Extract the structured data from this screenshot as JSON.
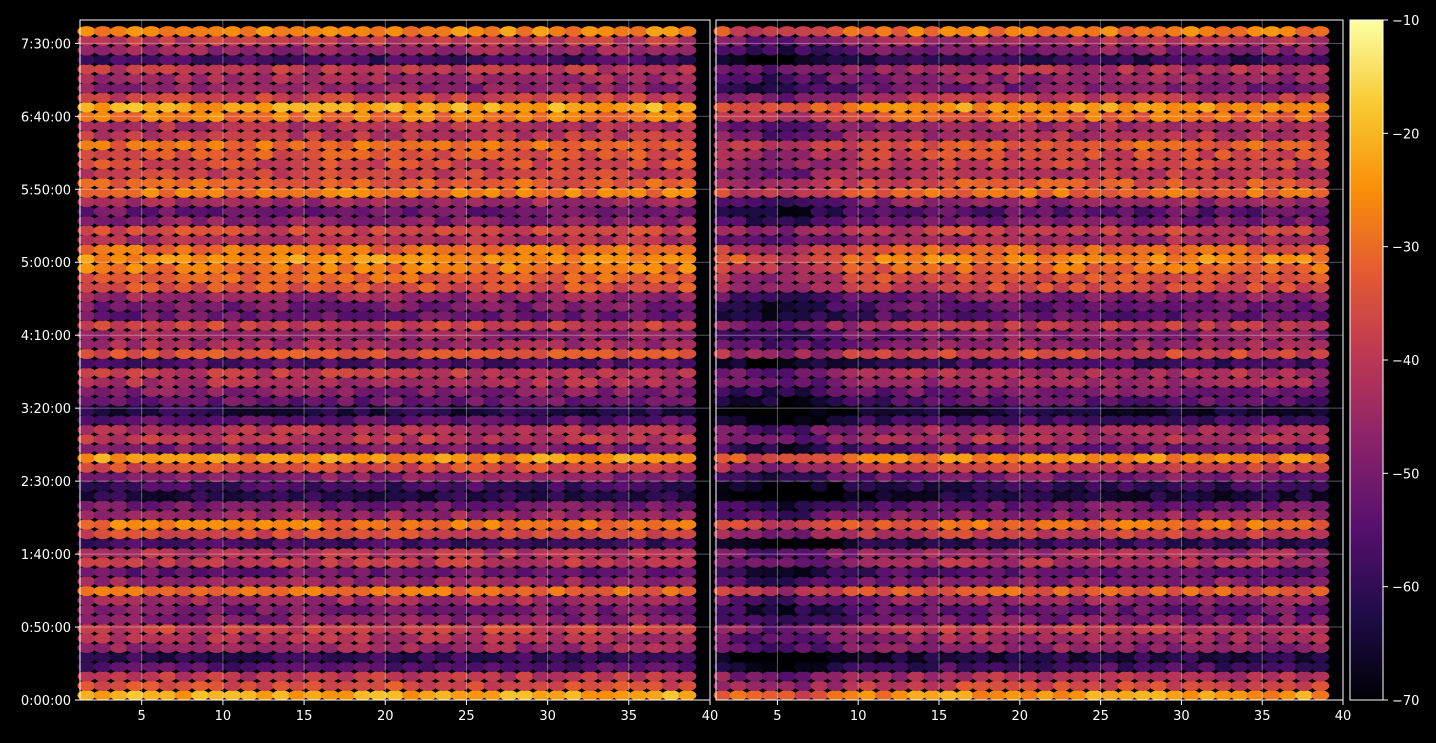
{
  "chart_data": {
    "type": "heatmap",
    "title": "",
    "xlabel": "",
    "ylabel": "",
    "panels": [
      {
        "name": "",
        "x_tick_labels": [
          "5",
          "10",
          "15",
          "20",
          "25",
          "30",
          "35",
          "40"
        ],
        "xlim": [
          1.2,
          40
        ]
      },
      {
        "name": "",
        "x_tick_labels": [
          "5",
          "10",
          "15",
          "20",
          "25",
          "30",
          "35",
          "40"
        ],
        "xlim": [
          1.2,
          40
        ]
      }
    ],
    "x_ticks": [
      5,
      10,
      15,
      20,
      25,
      30,
      35,
      40
    ],
    "y_ticks": [
      "0:00:00",
      "0:50:00",
      "1:40:00",
      "2:30:00",
      "3:20:00",
      "4:10:00",
      "5:00:00",
      "5:50:00",
      "6:40:00",
      "7:30:00"
    ],
    "ylim_seconds": [
      0,
      27960
    ],
    "row_interval_seconds": 600,
    "colorbar": {
      "colormap": "inferno",
      "ticks": [
        -10,
        -20,
        -30,
        -40,
        -50,
        -60,
        -70
      ],
      "tick_labels": [
        "−10",
        "−20",
        "−30",
        "−40",
        "−50",
        "−60",
        "−70"
      ],
      "range": [
        -70,
        -10
      ]
    },
    "grid": true,
    "row_profile_dB": [
      -22,
      -35,
      -40,
      -55,
      -60,
      -45,
      -42,
      -38,
      -48,
      -50,
      -44,
      -30,
      -46,
      -52,
      -40,
      -42,
      -58,
      -36,
      -28,
      -45,
      -50,
      -62,
      -58,
      -48,
      -36,
      -24,
      -50,
      -40,
      -42,
      -55,
      -62,
      -52,
      -48,
      -42,
      -40,
      -56,
      -34,
      -44,
      -46,
      -38,
      -52,
      -50,
      -46,
      -34,
      -32,
      -28,
      -24,
      -30,
      -42,
      -36,
      -48,
      -52,
      -44,
      -28,
      -32,
      -38,
      -36,
      -34,
      -30,
      -40,
      -42,
      -28,
      -22,
      -38,
      -48,
      -44,
      -40,
      -58,
      -46,
      -40,
      -26,
      -38
    ],
    "column_profile_dB": {
      "left": [
        0,
        0,
        0,
        0,
        0,
        0,
        0,
        0,
        0,
        0,
        0,
        0,
        0,
        0,
        0,
        0,
        0,
        0,
        0,
        0,
        0,
        0,
        0,
        0,
        0,
        0,
        0,
        0,
        0,
        0,
        0,
        0,
        0,
        0,
        0,
        0,
        0,
        0
      ],
      "right": [
        -6,
        -8,
        -10,
        -12,
        -12,
        -10,
        -8,
        -6,
        -4,
        -3,
        -2,
        -2,
        -1,
        -1,
        0,
        0,
        0,
        0,
        0,
        0,
        0,
        0,
        0,
        0,
        0,
        0,
        0,
        0,
        0,
        0,
        0,
        0,
        0,
        0,
        0,
        0,
        0,
        0
      ]
    }
  }
}
